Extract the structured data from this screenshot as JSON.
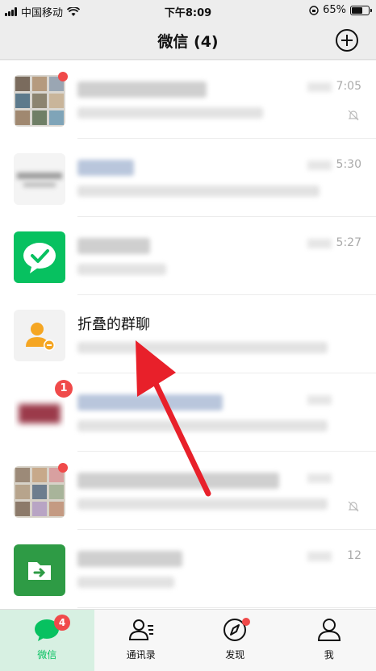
{
  "status_bar": {
    "carrier": "中国移动",
    "time": "下午8:09",
    "battery": "65%",
    "battery_level": 0.65
  },
  "header": {
    "title": "微信 (4)",
    "add_icon": "plus-circle-icon"
  },
  "chats": [
    {
      "time": "7:05",
      "muted": true,
      "red_dot": true
    },
    {
      "time": "5:30",
      "muted": false
    },
    {
      "time": "5:27",
      "muted": false
    },
    {
      "name": "折叠的群聊"
    },
    {
      "badge": "1"
    },
    {
      "red_dot": true,
      "muted": true
    },
    {
      "time": "12",
      "muted": false
    }
  ],
  "tabbar": {
    "tabs": [
      {
        "label": "微信",
        "badge": "4",
        "icon": "chat-bubble-icon"
      },
      {
        "label": "通讯录",
        "icon": "contacts-icon"
      },
      {
        "label": "发现",
        "icon": "compass-icon"
      },
      {
        "label": "我",
        "icon": "person-icon"
      }
    ]
  },
  "colors": {
    "accent": "#07c160",
    "badge": "#f04a4a",
    "arrow": "#e8202a"
  }
}
